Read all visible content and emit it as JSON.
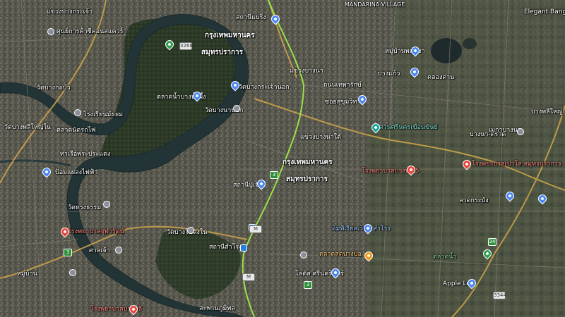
{
  "labels": {
    "pinklao_area": "Elegant Bangkok",
    "mandarina": "MANDARINA VILLAGE",
    "ketsuk_top": "แขวงบางกระเจ้า",
    "bkk_district_1": "กรุงเทพมหานคร",
    "samut_1": "สมุทรปราการ",
    "bkk_district_2": "กรุงเทพมหานคร",
    "samut_2": "สมุทรปราการ",
    "market": "ตลาดน้ำบางน้ำผึ้ง",
    "wat_kanlanat": "วัดบางนานอก",
    "wat_bangkachao": "วัดบางกระเจ้านอก",
    "wat_bangkasobai": "วัดบางกอบัว",
    "soi_1": "แขวงบางนา",
    "soi_2": "แขวงบางนาใต้",
    "road_1": "ถนนเทพารักษ์",
    "road_2": "ซอยสุขุมวิท",
    "road_3": "บางนา-ตราด",
    "hosp_1": "โรงพยาบาลบางนา 5",
    "hosp_2": "โรงพยาบาลเปาโล สมุทรปราการ",
    "hosp_3": "โรงพยาบาลจุฬารัตน์",
    "hosp_4": "โรงพยาบาลบางพลี",
    "temple_1": "วัดบางโฉลงใน",
    "park_1": "สวนศรีนครเขื่อนขันธ์",
    "mall_1": "ตลาดสดบางบ่อ",
    "mall_2": "อิมพีเรียลเวิลด์ สำโรง",
    "apple": "Apple Loft",
    "lotus": "โลตัส ศรีนครินทร์",
    "station_1": "สถานีแบริ่ง",
    "station_2": "สถานีสำโรง",
    "station_3": "สถานีปู่เจ้า",
    "misc_1": "หมู่บ้านพฤกษา",
    "misc_2": "คลองด่าน",
    "misc_3": "บางแก้ว",
    "misc_4": "ศูนย์การค้าซีคอนสแควร์",
    "misc_5": "โรงเรียนมัธยม",
    "misc_6": "ตลาดนัดรถไฟ",
    "misc_7": "ท่าเรือพระประแดง",
    "misc_8": "ป้อมแผลงไฟฟ้า",
    "misc_9": "วัดทรงธรรม",
    "misc_10": "ศาลเจ้า",
    "misc_11": "สะพานภูมิพล",
    "misc_12": "เมกาบางนา",
    "misc_13": "บางพลีใหญ่",
    "misc_14": "ลาดกระบัง",
    "misc_15": "ตลาดน้ำ",
    "misc_16": "วัดบางพลีใหญ่ใน",
    "misc_17": "หมู่บ้าน",
    "shield_1": "3",
    "shield_2": "3",
    "shield_3": "34",
    "shield_4": "3",
    "shield_5": "M",
    "shield_6": "M",
    "shield_7": "3344",
    "shield_8": "3268"
  },
  "colors": {
    "river": "#263a3c",
    "forest": "#2c3a27",
    "urban": "#5b5a52",
    "road_major": "#c9a24a",
    "road_minor": "#8a8676",
    "rail": "#9ae04a"
  }
}
